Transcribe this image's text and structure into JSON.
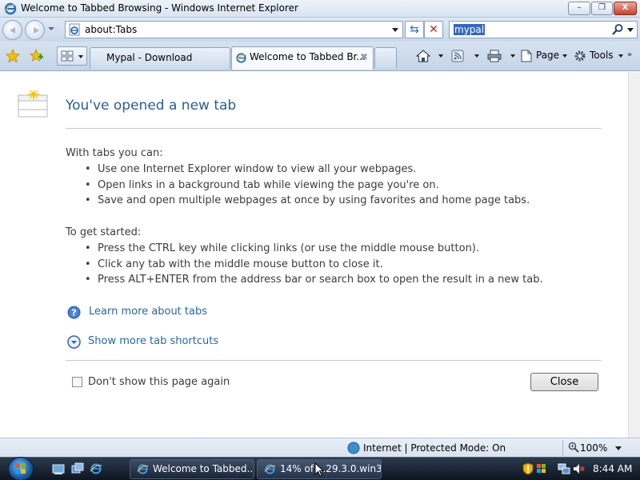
{
  "window": {
    "title": "Welcome to Tabbed Browsing - Windows Internet Explorer",
    "minimize_glyph": "–",
    "maximize_glyph": "❐",
    "close_glyph": "X"
  },
  "navigation": {
    "address": "about:Tabs",
    "search_value": "mypal",
    "refresh_glyph": "⇆",
    "stop_glyph": "✕"
  },
  "tabs": [
    {
      "label": "Mypal - Download"
    },
    {
      "label": "Welcome to Tabbed Br..."
    }
  ],
  "tab_close_glyph": "✖",
  "commands": {
    "page_label": "Page",
    "tools_label": "Tools",
    "more_glyph": "»"
  },
  "page": {
    "heading": "You've opened a new tab",
    "section1_title": "With tabs you can:",
    "section1_items": [
      "Use one Internet Explorer window to view all your webpages.",
      "Open links in a background tab while viewing the page you're on.",
      "Save and open multiple webpages at once by using favorites and home page tabs."
    ],
    "section2_title": "To get started:",
    "section2_items": [
      "Press the CTRL key while clicking links (or use the middle mouse button).",
      "Click any tab with the middle mouse button to close it.",
      "Press ALT+ENTER from the address bar or search box to open the result in a new tab."
    ],
    "learn_more_link": "Learn more about tabs",
    "show_shortcuts_link": "Show more tab shortcuts",
    "dont_show_label": "Don't show this page again",
    "close_button": "Close"
  },
  "status": {
    "zone": "Internet | Protected Mode: On",
    "zoom": "100%"
  },
  "taskbar": {
    "buttons": [
      {
        "label": "Welcome to Tabbed..."
      },
      {
        "label": "14% of ...29.3.0.win3..."
      }
    ],
    "clock": "8:44 AM"
  },
  "colors": {
    "heading": "#2a5d97",
    "link": "#2467ae",
    "search_highlight": "#3268c4"
  }
}
